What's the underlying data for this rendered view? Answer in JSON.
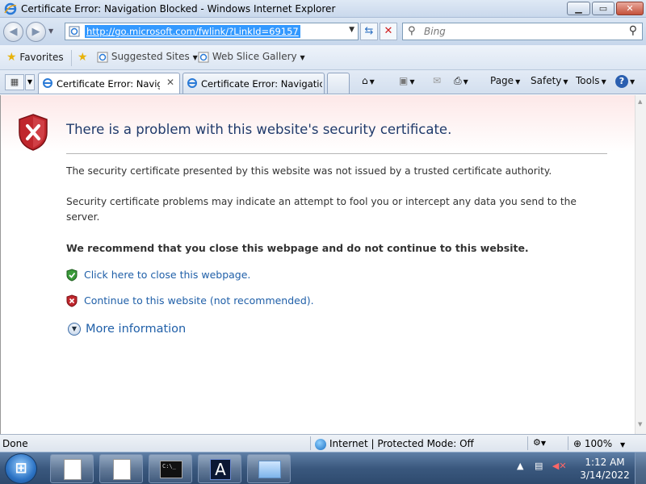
{
  "window": {
    "title": "Certificate Error: Navigation Blocked - Windows Internet Explorer",
    "min_glyph": "▁",
    "max_glyph": "▭",
    "close_glyph": "✕"
  },
  "nav": {
    "url": "http://go.microsoft.com/fwlink/?LinkId=69157",
    "search_placeholder": "Bing"
  },
  "favorites_bar": {
    "favorites_label": "Favorites",
    "items": [
      "Suggested Sites",
      "Web Slice Gallery"
    ]
  },
  "tabs": [
    {
      "label": "Certificate Error: Navig...",
      "active": true
    },
    {
      "label": "Certificate Error: Navigatio...",
      "active": false
    }
  ],
  "command_bar": {
    "page": "Page",
    "safety": "Safety",
    "tools": "Tools"
  },
  "content": {
    "heading": "There is a problem with this website's security certificate.",
    "para1": "The security certificate presented by this website was not issued by a trusted certificate authority.",
    "para2": "Security certificate problems may indicate an attempt to fool you or intercept any data you send to the server.",
    "recommend": "We recommend that you close this webpage and do not continue to this website.",
    "close_link": "Click here to close this webpage.",
    "continue_link": "Continue to this website (not recommended).",
    "more_info": "More information"
  },
  "status": {
    "text": "Done",
    "zone": "Internet | Protected Mode: Off",
    "zoom": "100%"
  },
  "taskbar": {
    "cmd_icon_text": "C:\\_",
    "a_icon_text": "A",
    "time": "1:12 AM",
    "date": "3/14/2022"
  },
  "colors": {
    "heading": "#1f3a6b",
    "link": "#1f5fa8",
    "url_highlight": "#3399ff",
    "error_shield": "#c0272d",
    "ok_shield": "#3a9a3a"
  }
}
